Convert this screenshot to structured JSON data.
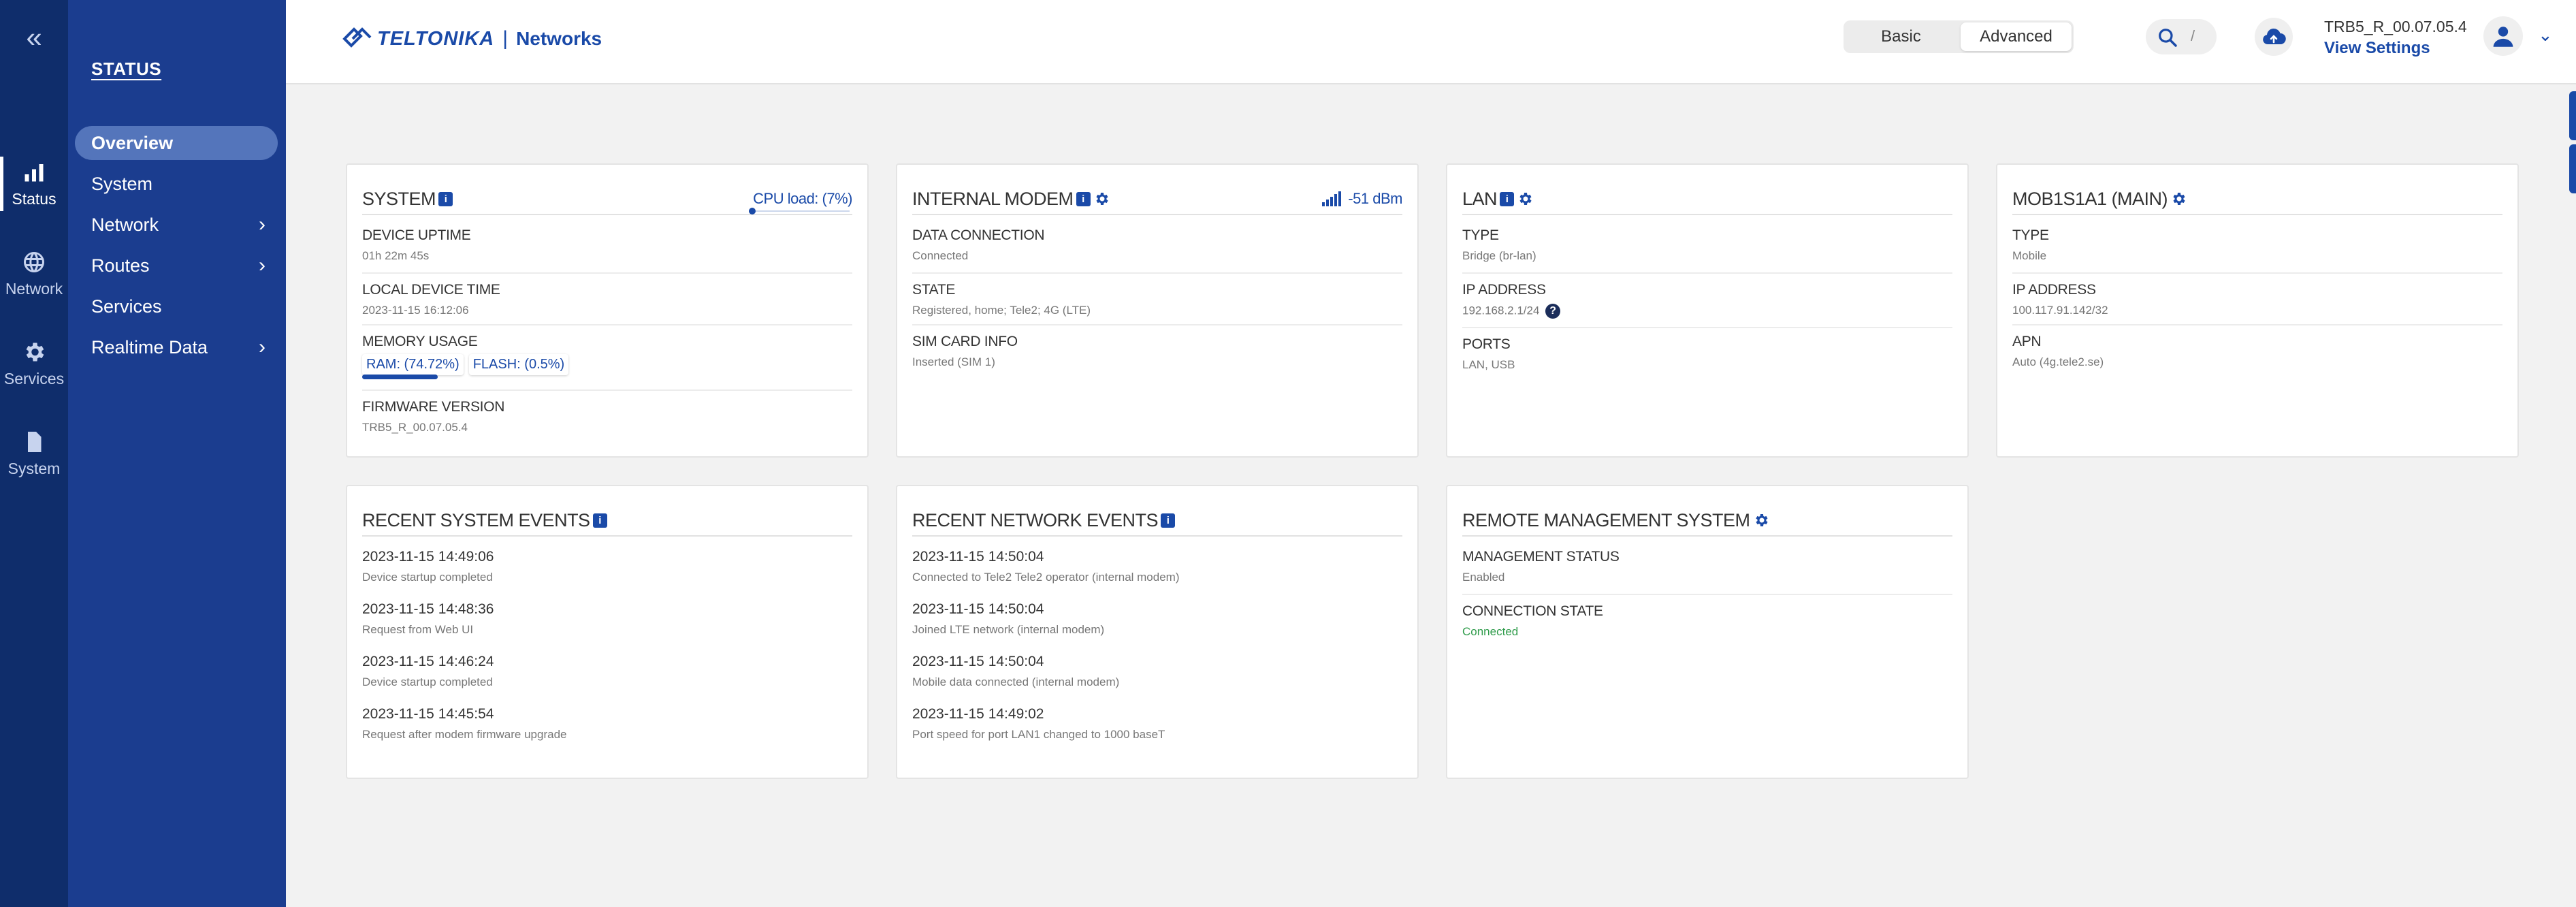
{
  "rail": {
    "collapse_glyph": "«",
    "items": [
      {
        "label": "Status",
        "icon": "status-icon"
      },
      {
        "label": "Network",
        "icon": "globe-icon"
      },
      {
        "label": "Services",
        "icon": "gear-icon"
      },
      {
        "label": "System",
        "icon": "file-icon"
      }
    ]
  },
  "sidebar": {
    "heading": "STATUS",
    "items": [
      {
        "label": "Overview",
        "chevron": ""
      },
      {
        "label": "System",
        "chevron": ""
      },
      {
        "label": "Network",
        "chevron": "›"
      },
      {
        "label": "Routes",
        "chevron": "›"
      },
      {
        "label": "Services",
        "chevron": ""
      },
      {
        "label": "Realtime Data",
        "chevron": "›"
      }
    ]
  },
  "header": {
    "brand": "TELTONIKA",
    "separator": "|",
    "brand_sub": "Networks",
    "mode": {
      "basic": "Basic",
      "advanced": "Advanced",
      "selected": "Advanced"
    },
    "search_shortcut": "/",
    "firmware_version": "TRB5_R_00.07.05.4",
    "view_settings": "View Settings",
    "user_dropdown": "⌄"
  },
  "cards": {
    "system": {
      "title": "SYSTEM",
      "badge": "i",
      "cpu_label": "CPU load: (7%)",
      "cpu_load": 0.07,
      "uptime_label": "DEVICE UPTIME",
      "uptime_value": "01h 22m 45s",
      "time_label": "LOCAL DEVICE TIME",
      "time_value": "2023-11-15 16:12:06",
      "memory_label": "MEMORY USAGE",
      "ram_label": "RAM: (74.72%)",
      "ram_usage": 0.7472,
      "flash_label": "FLASH: (0.5%)",
      "flash_usage": 0.005,
      "firmware_label": "FIRMWARE VERSION",
      "firmware_value": "TRB5_R_00.07.05.4"
    },
    "modem": {
      "title": "INTERNAL MODEM",
      "badge": "i",
      "signal": "-51 dBm",
      "data_label": "DATA CONNECTION",
      "data_value": "Connected",
      "state_label": "STATE",
      "state_value": "Registered, home; Tele2; 4G (LTE)",
      "sim_label": "SIM CARD INFO",
      "sim_value": "Inserted (SIM 1)"
    },
    "lan": {
      "title": "LAN",
      "badge": "i",
      "type_label": "TYPE",
      "type_value": "Bridge (br-lan)",
      "ip_label": "IP ADDRESS",
      "ip_value": "192.168.2.1/24",
      "ip_help": "?",
      "ports_label": "PORTS",
      "ports_value": "LAN, USB"
    },
    "mob": {
      "title": "MOB1S1A1 (MAIN)",
      "type_label": "TYPE",
      "type_value": "Mobile",
      "ip_label": "IP ADDRESS",
      "ip_value": "100.117.91.142/32",
      "apn_label": "APN",
      "apn_value": "Auto (4g.tele2.se)"
    },
    "sys_events": {
      "title": "RECENT SYSTEM EVENTS",
      "badge": "i",
      "events": [
        {
          "time": "2023-11-15 14:49:06",
          "desc": "Device startup completed"
        },
        {
          "time": "2023-11-15 14:48:36",
          "desc": "Request from Web UI"
        },
        {
          "time": "2023-11-15 14:46:24",
          "desc": "Device startup completed"
        },
        {
          "time": "2023-11-15 14:45:54",
          "desc": "Request after modem firmware upgrade"
        }
      ]
    },
    "net_events": {
      "title": "RECENT NETWORK EVENTS",
      "badge": "i",
      "events": [
        {
          "time": "2023-11-15 14:50:04",
          "desc": "Connected to Tele2 Tele2 operator (internal modem)"
        },
        {
          "time": "2023-11-15 14:50:04",
          "desc": "Joined LTE network (internal modem)"
        },
        {
          "time": "2023-11-15 14:50:04",
          "desc": "Mobile data connected (internal modem)"
        },
        {
          "time": "2023-11-15 14:49:02",
          "desc": "Port speed for port LAN1 changed to 1000 baseT"
        }
      ]
    },
    "rms": {
      "title": "REMOTE MANAGEMENT SYSTEM",
      "status_label": "MANAGEMENT STATUS",
      "status_value": "Enabled",
      "conn_label": "CONNECTION STATE",
      "conn_value": "Connected"
    }
  },
  "colors": {
    "primary": "#1a4aa8",
    "rail": "#0f2d6b",
    "sidebar": "#1b3d8f",
    "success": "#2e9b4a"
  }
}
